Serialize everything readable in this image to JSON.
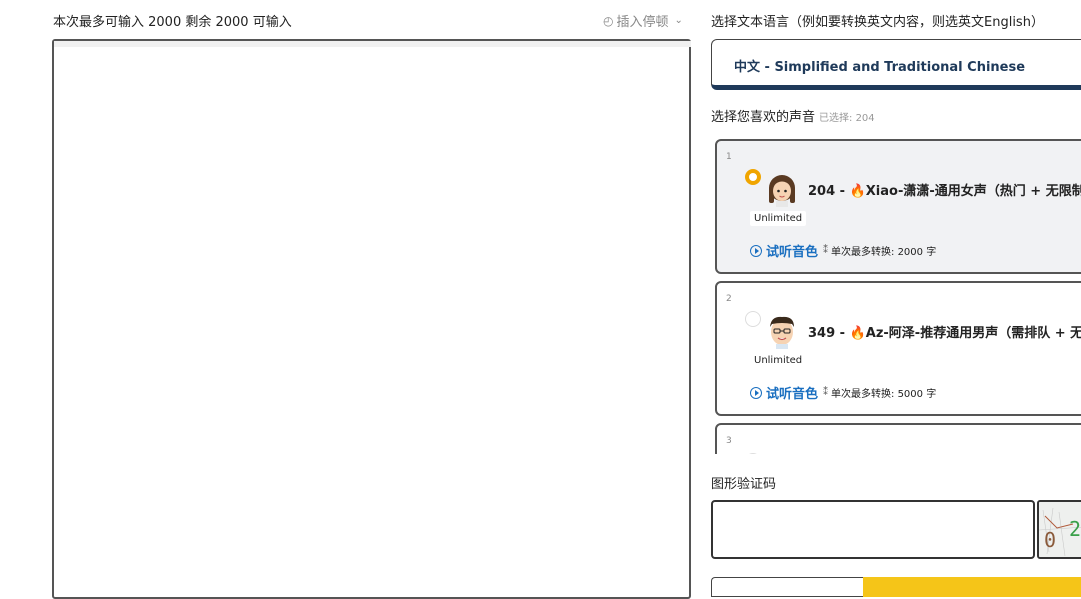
{
  "editor": {
    "counter_text": "本次最多可输入 2000 剩余 2000 可输入",
    "insert_pause_label": "插入停顿",
    "textarea_value": ""
  },
  "language": {
    "label": "选择文本语言（例如要转换英文内容，则选英文English）",
    "selected": "中文 - Simplified and Traditional Chinese"
  },
  "voices": {
    "label": "选择您喜欢的声音",
    "selected_note": "已选择: 204",
    "items": [
      {
        "number": "1",
        "selected": true,
        "name_prefix": "204 - ",
        "fire": "🔥",
        "name": "Xiao-潇潇-通用女声（热门 + 无限制",
        "tag": "Unlimited",
        "preview_label": "试听音色",
        "max_chars": "单次最多转换: 2000 字"
      },
      {
        "number": "2",
        "selected": false,
        "name_prefix": "349 - ",
        "fire": "🔥",
        "name": "Az-阿泽-推荐通用男声（需排队 + 无",
        "tag": "Unlimited",
        "preview_label": "试听音色",
        "max_chars": "单次最多转换: 5000 字"
      },
      {
        "number": "3",
        "selected": false
      }
    ]
  },
  "captcha": {
    "label": "图形验证码",
    "input_value": "",
    "image_chars": "0 2"
  },
  "colors": {
    "accent_orange": "#f0a500",
    "link_blue": "#1a6fc0",
    "navy": "#1f3a5a",
    "yellow_button": "#f5c518"
  },
  "icons": {
    "pause": "clock-icon",
    "dropdown": "chevron-down-icon",
    "play": "play-circle-icon",
    "sparkle": "sparkle-icon"
  }
}
